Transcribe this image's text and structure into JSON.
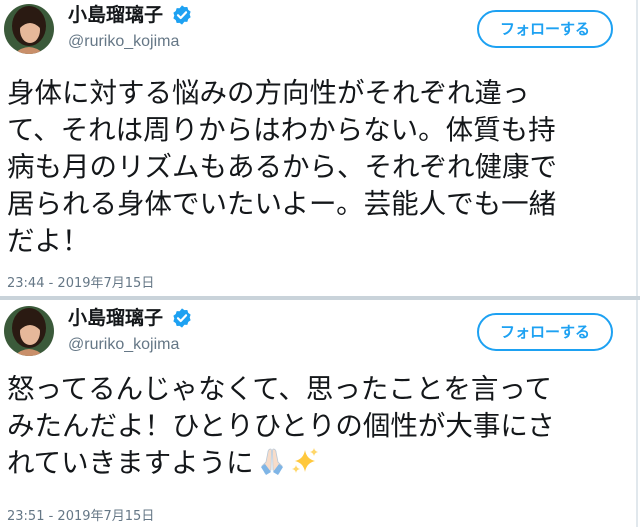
{
  "tweets": [
    {
      "display_name": "小島瑠璃子",
      "handle": "@ruriko_kojima",
      "follow_label": "フォローする",
      "lines": [
        "身体に対する悩みの方向性がそれぞれ違っ",
        "て、それは周りからはわからない。体質も持",
        "病も月のリズムもあるから、それぞれ健康で",
        "居られる身体でいたいよー。芸能人でも一緒",
        "だよ！"
      ],
      "timestamp": "23:44 - 2019年7月15日"
    },
    {
      "display_name": "小島瑠璃子",
      "handle": "@ruriko_kojima",
      "follow_label": "フォローする",
      "lines": [
        "怒ってるんじゃなくて、思ったことを言って",
        "みたんだよ！ひとりひとりの個性が大事にさ",
        "れていきますように"
      ],
      "emojis": [
        "folded-hands",
        "sparkles"
      ],
      "timestamp": "23:51 - 2019年7月15日"
    }
  ],
  "colors": {
    "accent": "#1da1f2",
    "text": "#14171a",
    "muted": "#657786",
    "divider": "#c9d3da"
  }
}
